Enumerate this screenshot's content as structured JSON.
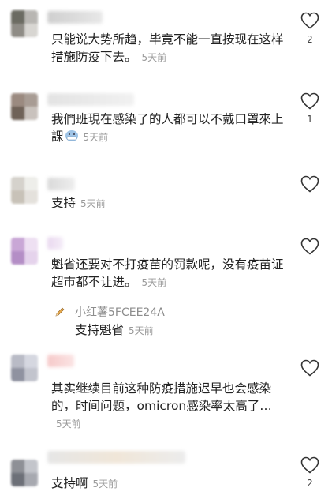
{
  "comments": [
    {
      "text": "只能说大势所趋，毕竟不能一直按现在这样措施防疫下去。",
      "time": "5天前",
      "likes": "2"
    },
    {
      "text": "我們班現在感染了的人都可以不戴口罩來上課",
      "time": "5天前",
      "likes": "1"
    },
    {
      "text": "支持",
      "time": "5天前",
      "likes": ""
    },
    {
      "text": "魁省还要对不打疫苗的罚款呢，没有疫苗证超市都不让进。",
      "time": "5天前",
      "likes": "",
      "reply": {
        "user": "小红薯5FCEE24A",
        "text": "支持魁省",
        "time": "5天前"
      }
    },
    {
      "text": "其实继续目前这种防疫措施迟早也会感染的，时间问题，omicron感染率太高了…",
      "time": "5天前",
      "likes": ""
    },
    {
      "text": "支持啊",
      "time": "5天前",
      "likes": "2"
    }
  ],
  "icons": {
    "like": "heart-outline-icon",
    "reply_avatar": "pencil-icon",
    "emoji": "mask-face-emoji-icon"
  },
  "colors": {
    "text": "#222222",
    "meta": "#9a9a9a",
    "icon": "#333333"
  }
}
